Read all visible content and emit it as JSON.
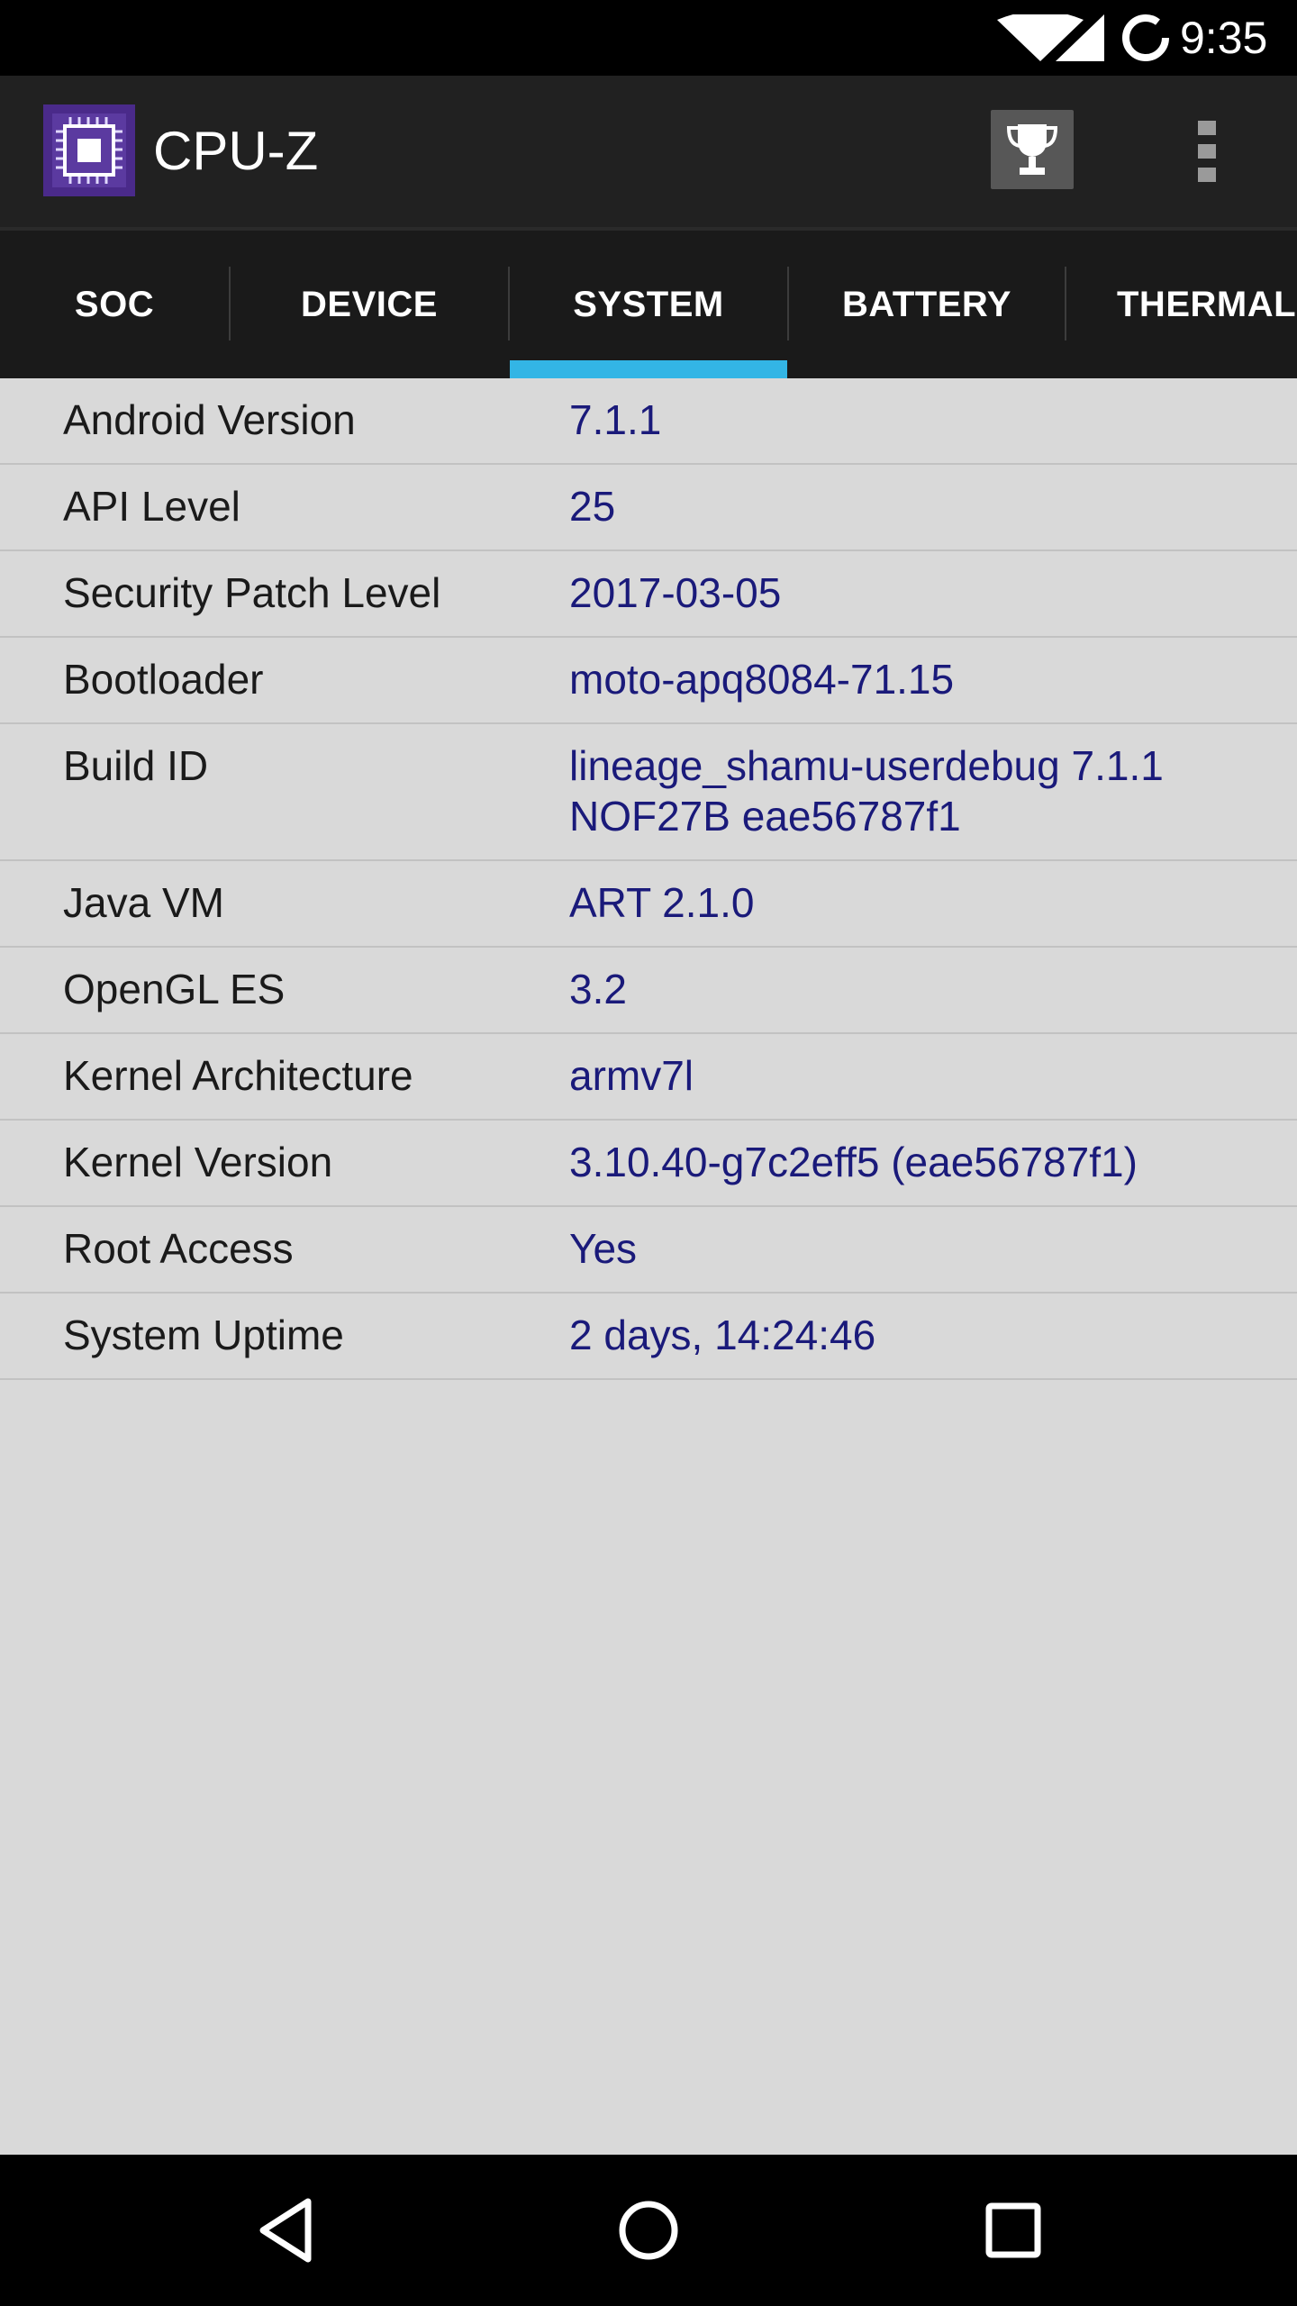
{
  "status_bar": {
    "time": "9:35",
    "icons": [
      "wifi-icon",
      "cell-signal-icon",
      "battery-charging-icon"
    ]
  },
  "app_bar": {
    "title": "CPU-Z",
    "icons": [
      "cpu-chip-icon",
      "trophy-icon",
      "overflow-menu-icon"
    ]
  },
  "tabs": [
    {
      "label": "SOC"
    },
    {
      "label": "DEVICE"
    },
    {
      "label": "SYSTEM",
      "selected": true
    },
    {
      "label": "BATTERY"
    },
    {
      "label": "THERMAL"
    }
  ],
  "system_info": [
    {
      "label": "Android Version",
      "value": "7.1.1"
    },
    {
      "label": "API Level",
      "value": "25"
    },
    {
      "label": "Security Patch Level",
      "value": "2017-03-05"
    },
    {
      "label": "Bootloader",
      "value": "moto-apq8084-71.15"
    },
    {
      "label": "Build ID",
      "value": "lineage_shamu-userdebug 7.1.1 NOF27B eae56787f1"
    },
    {
      "label": "Java VM",
      "value": "ART 2.1.0"
    },
    {
      "label": "OpenGL ES",
      "value": "3.2"
    },
    {
      "label": "Kernel Architecture",
      "value": "armv7l"
    },
    {
      "label": "Kernel Version",
      "value": "3.10.40-g7c2eff5 (eae56787f1)"
    },
    {
      "label": "Root Access",
      "value": "Yes"
    },
    {
      "label": "System Uptime",
      "value": "2 days, 14:24:46"
    }
  ],
  "nav_bar": {
    "icons": [
      "back-icon",
      "home-icon",
      "recents-icon"
    ]
  },
  "colors": {
    "accent": "#33b5e5",
    "value_text": "#1a1a7a",
    "app_icon_bg": "#4a2a8a"
  }
}
